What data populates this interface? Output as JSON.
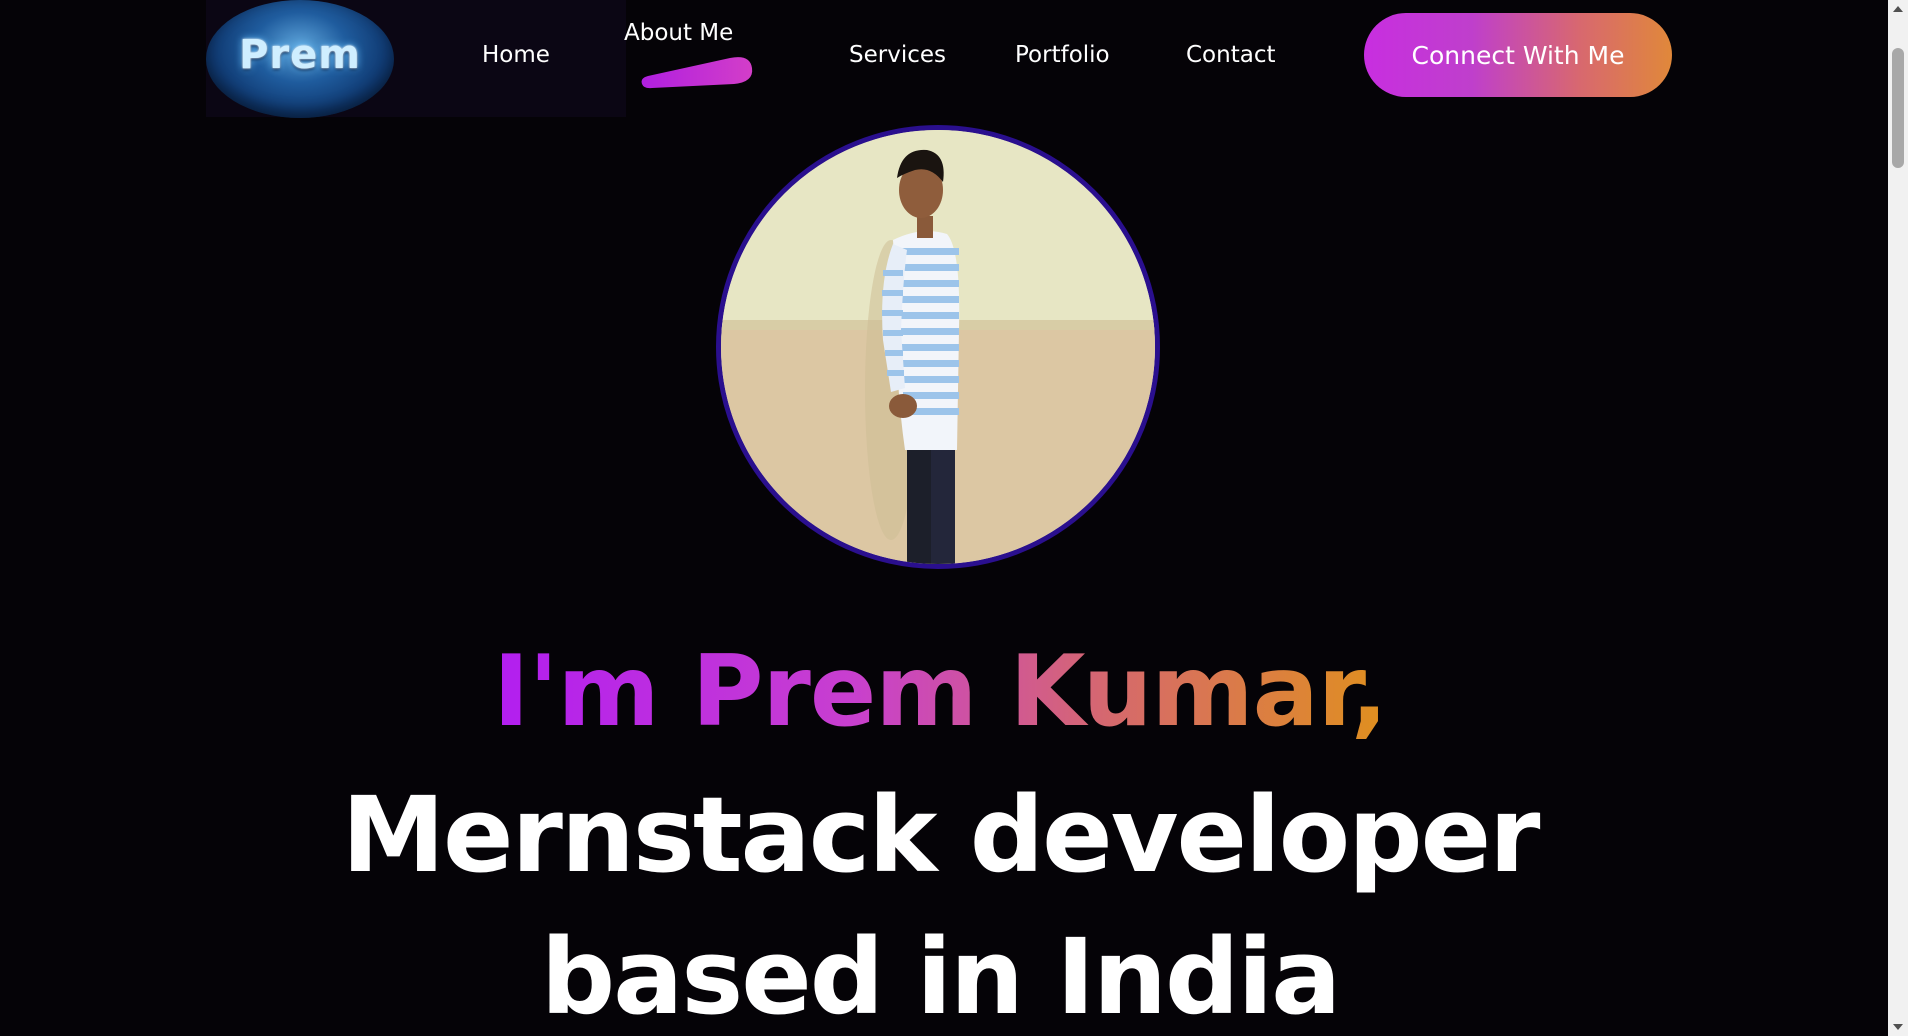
{
  "header": {
    "logo_text": "Prem",
    "nav": {
      "home": "Home",
      "about": "About Me",
      "services": "Services",
      "portfolio": "Portfolio",
      "contact": "Contact"
    },
    "active_nav": "about",
    "cta_label": "Connect With Me"
  },
  "hero": {
    "greeting": "I'm Prem Kumar,",
    "line_2": "Mernstack developer",
    "line_3": "based in India",
    "profile_image": "profile-photo"
  },
  "colors": {
    "background": "#050307",
    "accent_gradient_start": "#b21ef0",
    "accent_gradient_end": "#e0901e",
    "profile_border": "#2a0f8e",
    "text": "#ffffff"
  }
}
